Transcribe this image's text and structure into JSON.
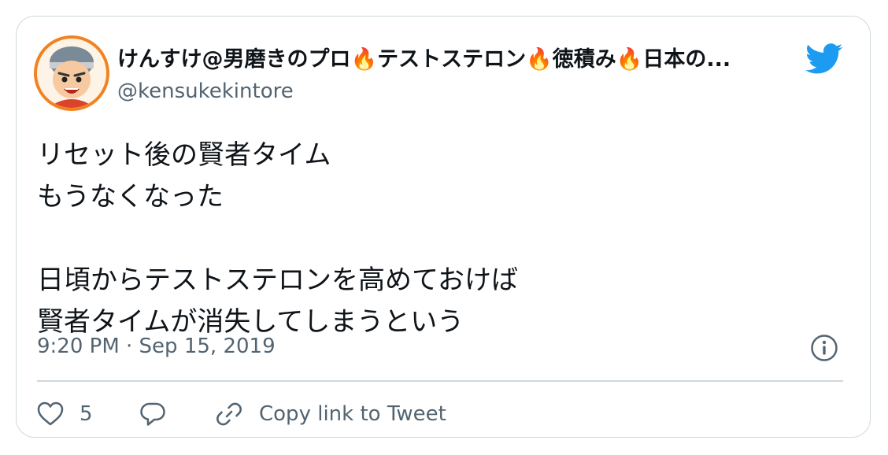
{
  "author": {
    "display_name": "けんすけ@男磨きのプロ🔥テストステロン🔥徳積み🔥日本の...",
    "handle": "@kensukekintore",
    "avatar_icon": "avatar-cartoon-man",
    "avatar_ring_color": "#f4811f"
  },
  "tweet": {
    "lines": [
      "リセット後の賢者タイム",
      "もうなくなった",
      "",
      "日頃からテストステロンを高めておけば",
      "賢者タイムが消失してしまうという"
    ],
    "timestamp": "9:20 PM · Sep 15, 2019"
  },
  "actions": {
    "like_count": "5",
    "copy_link_label": "Copy link to Tweet"
  },
  "icons": {
    "brand": "twitter-bird-icon",
    "info": "info-icon",
    "like": "heart-icon",
    "reply": "reply-bubble-icon",
    "link": "link-icon"
  },
  "colors": {
    "brand_blue": "#1d9bf0",
    "text_primary": "#0f1419",
    "text_secondary": "#536471",
    "border": "#cfd9de"
  }
}
